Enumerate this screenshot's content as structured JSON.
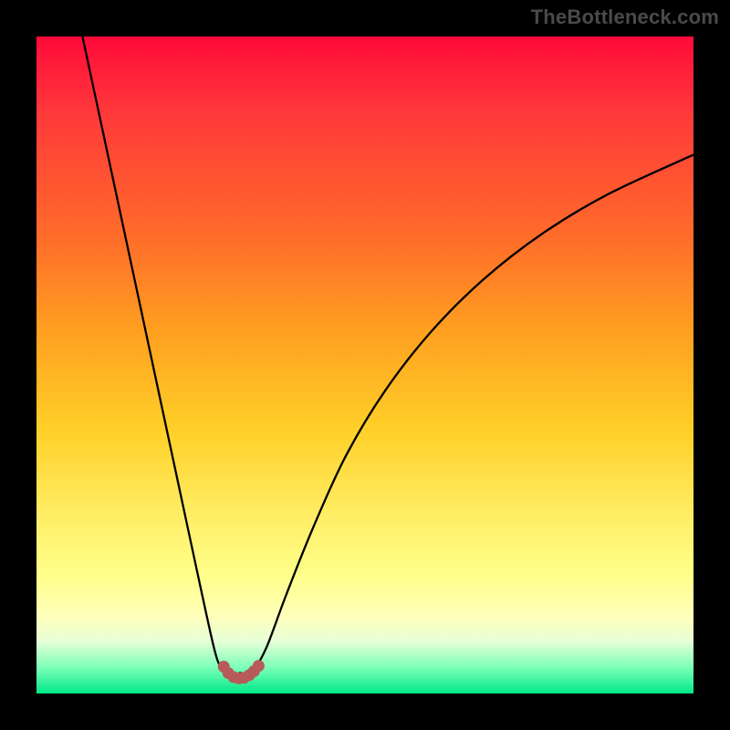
{
  "watermark": "TheBottleneck.com",
  "chart_data": {
    "type": "line",
    "title": "",
    "xlabel": "",
    "ylabel": "",
    "xlim": [
      0,
      100
    ],
    "ylim": [
      0,
      100
    ],
    "grid": false,
    "legend": false,
    "series": [
      {
        "name": "left-curve",
        "x": [
          7,
          10,
          13,
          16,
          19,
          22,
          25,
          27,
          28,
          29,
          30,
          31
        ],
        "y": [
          100,
          86,
          72,
          58,
          44,
          30,
          16,
          7,
          4,
          2.6,
          2.3,
          3.2
        ]
      },
      {
        "name": "right-curve",
        "x": [
          31,
          32,
          33,
          35,
          38,
          42,
          47,
          53,
          60,
          68,
          77,
          87,
          100
        ],
        "y": [
          3.2,
          2.5,
          3.4,
          7,
          15,
          25,
          36,
          46,
          55,
          63,
          70,
          76,
          82
        ]
      },
      {
        "name": "bottom-arc",
        "x": [
          28.5,
          29.2,
          30,
          30.8,
          31.6,
          32.4,
          33.1,
          33.8
        ],
        "y": [
          4.1,
          3.1,
          2.5,
          2.3,
          2.4,
          2.8,
          3.4,
          4.2
        ]
      }
    ],
    "marker_series": "bottom-arc",
    "marker_color": "#b85a5a",
    "curve_color": "#000000"
  }
}
